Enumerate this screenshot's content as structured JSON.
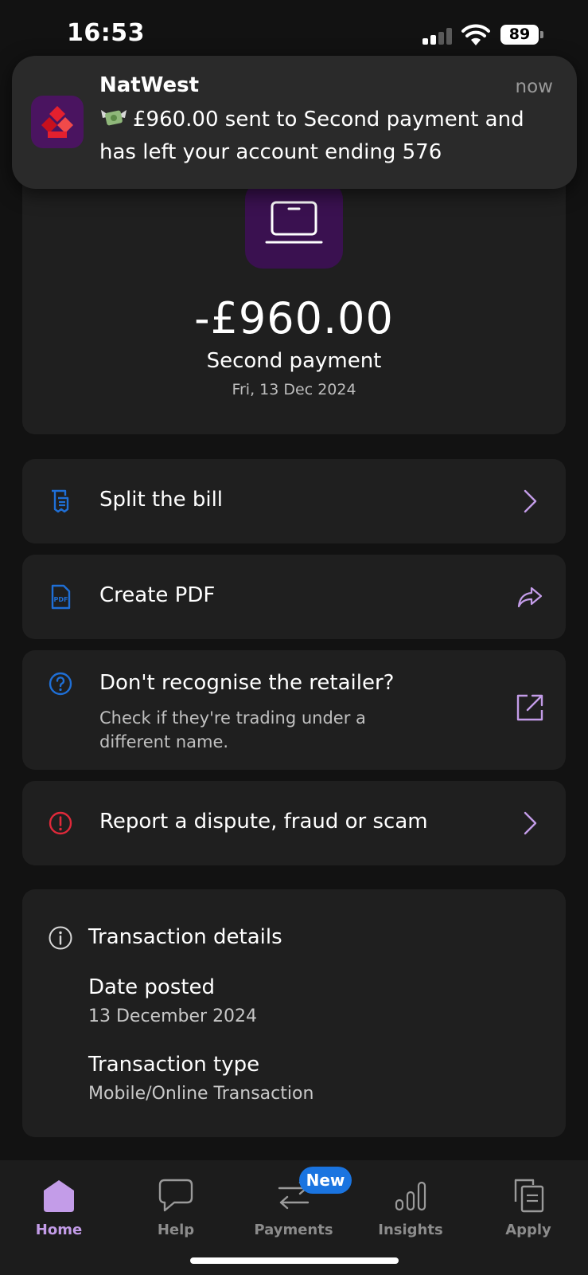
{
  "status_bar": {
    "time": "16:53",
    "battery": "89"
  },
  "notification": {
    "app": "NatWest",
    "time": "now",
    "message": "£960.00 sent to Second payment and has left your account ending 576"
  },
  "transaction": {
    "amount": "-£960.00",
    "payee": "Second payment",
    "date": "Fri, 13 Dec 2024"
  },
  "actions": {
    "split": {
      "label": "Split the bill"
    },
    "pdf": {
      "label": "Create PDF"
    },
    "retailer": {
      "label": "Don't recognise the retailer?",
      "sub": "Check if they're trading under a different name."
    },
    "dispute": {
      "label": "Report a dispute, fraud or scam"
    }
  },
  "details": {
    "title": "Transaction details",
    "date_posted_label": "Date posted",
    "date_posted_value": "13 December 2024",
    "type_label": "Transaction type",
    "type_value": "Mobile/Online Transaction"
  },
  "tabs": {
    "home": "Home",
    "help": "Help",
    "payments": "Payments",
    "payments_badge": "New",
    "insights": "Insights",
    "apply": "Apply"
  },
  "colors": {
    "accent": "#c39ce8",
    "icon_blue": "#1f6fd6",
    "alert_red": "#e0293a",
    "merchant_tile": "#3a1150"
  }
}
